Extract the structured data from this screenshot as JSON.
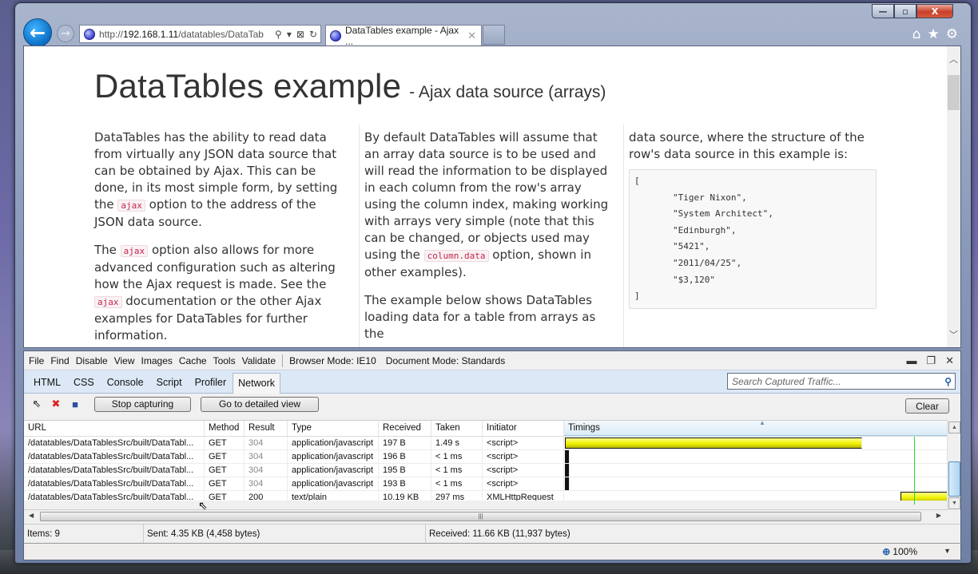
{
  "browser": {
    "address_url_prefix": "http://",
    "address_url_host": "192.168.1.11",
    "address_url_path": "/datatables/DataTab",
    "tab_title": "DataTables example - Ajax ...",
    "icons": {
      "back": "←",
      "forward": "→",
      "search": "⚲",
      "dropdown": "▾",
      "compat": "⊠",
      "refresh": "↻",
      "tab_close": "✕",
      "home": "⌂",
      "favorites": "★",
      "tools": "⚙"
    },
    "caption": {
      "minimize": "—",
      "maximize": "▫",
      "close": "X"
    }
  },
  "page": {
    "title": "DataTables example",
    "subtitle": "- Ajax data source (arrays)",
    "col1": {
      "p1_a": "DataTables has the ability to read data from virtually any JSON data source that can be obtained by Ajax. This can be done, in its most simple form, by setting the ",
      "p1_code": "ajax",
      "p1_b": " option to the address of the JSON data source.",
      "p2_a": "The ",
      "p2_code1": "ajax",
      "p2_b": " option also allows for more advanced configuration such as altering how the Ajax request is made. See the ",
      "p2_code2": "ajax",
      "p2_c": " documentation or the other Ajax examples for DataTables for further information."
    },
    "col2": {
      "p1_a": "By default DataTables will assume that an array data source is to be used and will read the information to be displayed in each column from the row's array using the column index, making working with arrays very simple (note that this can be changed, or objects used may using the ",
      "p1_code": "column.data",
      "p1_b": " option, shown in other examples).",
      "p2": "The example below shows DataTables loading data for a table from arrays as the"
    },
    "col3": {
      "p1": "data source, where the structure of the row's data source in this example is:",
      "code_open": "[",
      "code_lines": [
        "\"Tiger Nixon\",",
        "\"System Architect\",",
        "\"Edinburgh\",",
        "\"5421\",",
        "\"2011/04/25\",",
        "\"$3,120\""
      ],
      "code_close": "]"
    }
  },
  "devtools": {
    "menu": [
      "File",
      "Find",
      "Disable",
      "View",
      "Images",
      "Cache",
      "Tools",
      "Validate"
    ],
    "browser_mode": "Browser Mode: IE10",
    "document_mode": "Document Mode: Standards",
    "window_icons": {
      "minimize": "▬",
      "restore": "❐",
      "close": "✕"
    },
    "tabs": [
      "HTML",
      "CSS",
      "Console",
      "Script",
      "Profiler",
      "Network"
    ],
    "active_tab": "Network",
    "search_placeholder": "Search Captured Traffic...",
    "toolbar": {
      "stop_capturing": "Stop capturing",
      "detailed_view": "Go to detailed view",
      "clear": "Clear",
      "icons": {
        "select": "⇖",
        "clear_cache": "✖",
        "save": "■"
      }
    },
    "columns": [
      "URL",
      "Method",
      "Result",
      "Type",
      "Received",
      "Taken",
      "Initiator",
      "Timings"
    ],
    "rows": [
      {
        "url": "/datatables/DataTablesSrc/built/DataTabl...",
        "method": "GET",
        "result": "304",
        "type": "application/javascript",
        "received": "197 B",
        "taken": "1.49 s",
        "initiator": "<script>",
        "timing_start": 0.0,
        "timing_end": 0.776
      },
      {
        "url": "/datatables/DataTablesSrc/built/DataTabl...",
        "method": "GET",
        "result": "304",
        "type": "application/javascript",
        "received": "196 B",
        "taken": "< 1 ms",
        "initiator": "<script>",
        "timing_start": 0.0,
        "timing_end": 0.0
      },
      {
        "url": "/datatables/DataTablesSrc/built/DataTabl...",
        "method": "GET",
        "result": "304",
        "type": "application/javascript",
        "received": "195 B",
        "taken": "< 1 ms",
        "initiator": "<script>",
        "timing_start": 0.0,
        "timing_end": 0.0
      },
      {
        "url": "/datatables/DataTablesSrc/built/DataTabl...",
        "method": "GET",
        "result": "304",
        "type": "application/javascript",
        "received": "193 B",
        "taken": "< 1 ms",
        "initiator": "<script>",
        "timing_start": 0.0,
        "timing_end": 0.0
      },
      {
        "url": "/datatables/DataTablesSrc/built/DataTabl...",
        "method": "GET",
        "result": "200",
        "type": "text/plain",
        "received": "10.19 KB",
        "taken": "297 ms",
        "initiator": "XMLHttpRequest",
        "timing_start": 0.876,
        "timing_end": 1.0
      }
    ],
    "status": {
      "items": "Items: 9",
      "sent": "Sent: 4.35 KB (4,458 bytes)",
      "received": "Received: 11.66 KB (11,937 bytes)"
    }
  },
  "statusbar": {
    "zoom": "100%",
    "zoom_icon": "⊕",
    "zoom_dropdown": "▼"
  },
  "colors": {
    "accent_back": "#0a6fc4",
    "timing_bar": "#f0f000",
    "dom_line": "#22dd22",
    "code_text": "#c7254e"
  }
}
